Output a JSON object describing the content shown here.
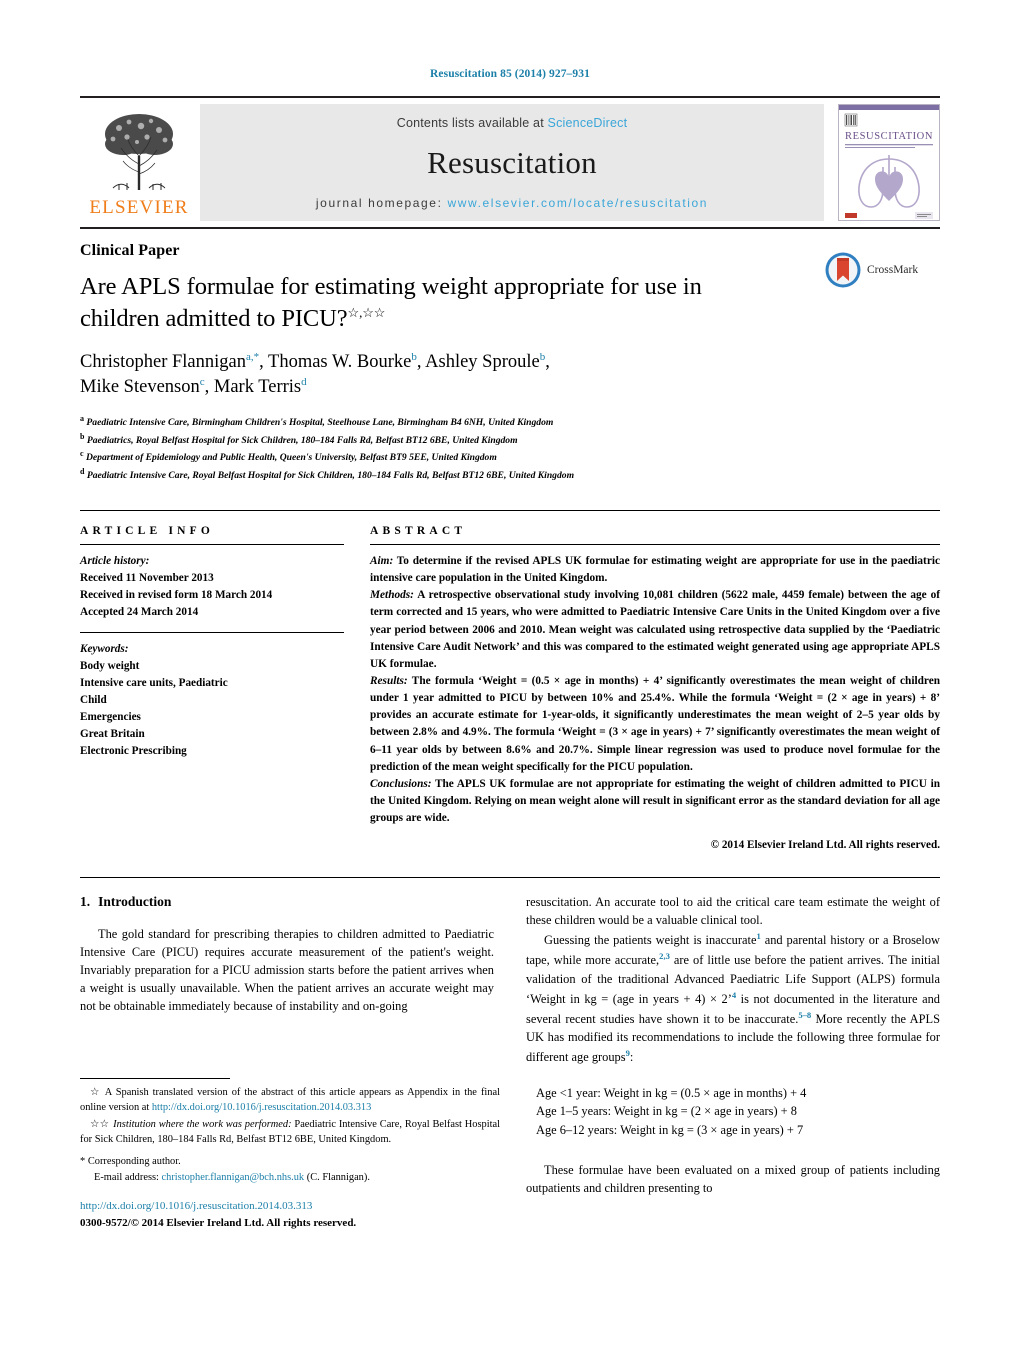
{
  "running_head": "Resuscitation 85 (2014) 927–931",
  "banner": {
    "publisher": "ELSEVIER",
    "contents_prefix": "Contents lists available at ",
    "contents_link": "ScienceDirect",
    "journal_name": "Resuscitation",
    "homepage_prefix": "journal homepage: ",
    "homepage_url": "www.elsevier.com/locate/resuscitation",
    "cover_title": "RESUSCITATION",
    "cover_subtitle": "OFFICIAL JOURNAL OF THE EUROPEAN RESUSCITATION COUNCIL"
  },
  "colors": {
    "link_blue": "#1b7fa8",
    "sciencedirect_blue": "#3aa6d8",
    "elsevier_orange": "#ef7d1a",
    "banner_grey": "#e8e8e9"
  },
  "article": {
    "kicker": "Clinical Paper",
    "title": "Are APLS formulae for estimating weight appropriate for use in children admitted to PICU?",
    "title_marks": "☆,☆☆",
    "authors_line1": "Christopher Flannigan",
    "authors": "Christopher Flannigan a,*, Thomas W. Bourke b, Ashley Sproule b, Mike Stevenson c, Mark Terris d",
    "affiliations": [
      {
        "mark": "a",
        "text": "Paediatric Intensive Care, Birmingham Children's Hospital, Steelhouse Lane, Birmingham B4 6NH, United Kingdom"
      },
      {
        "mark": "b",
        "text": "Paediatrics, Royal Belfast Hospital for Sick Children, 180–184 Falls Rd, Belfast BT12 6BE, United Kingdom"
      },
      {
        "mark": "c",
        "text": "Department of Epidemiology and Public Health, Queen's University, Belfast BT9 5EE, United Kingdom"
      },
      {
        "mark": "d",
        "text": "Paediatric Intensive Care, Royal Belfast Hospital for Sick Children, 180–184 Falls Rd, Belfast BT12 6BE, United Kingdom"
      }
    ],
    "crossmark_label": "CrossMark"
  },
  "article_info": {
    "heading": "ARTICLE INFO",
    "history_label": "Article history:",
    "history": [
      "Received 11 November 2013",
      "Received in revised form 18 March 2014",
      "Accepted 24 March 2014"
    ],
    "keywords_label": "Keywords:",
    "keywords": [
      "Body weight",
      "Intensive care units, Paediatric",
      "Child",
      "Emergencies",
      "Great Britain",
      "Electronic Prescribing"
    ]
  },
  "abstract": {
    "heading": "ABSTRACT",
    "aim_label": "Aim:",
    "aim_text": " To determine if the revised APLS UK formulae for estimating weight are appropriate for use in the paediatric intensive care population in the United Kingdom.",
    "methods_label": "Methods:",
    "methods_text": " A retrospective observational study involving 10,081 children (5622 male, 4459 female) between the age of term corrected and 15 years, who were admitted to Paediatric Intensive Care Units in the United Kingdom over a five year period between 2006 and 2010. Mean weight was calculated using retrospective data supplied by the ‘Paediatric Intensive Care Audit Network’ and this was compared to the estimated weight generated using age appropriate APLS UK formulae.",
    "results_label": "Results:",
    "results_text": " The formula ‘Weight = (0.5 × age in months) + 4’ significantly overestimates the mean weight of children under 1 year admitted to PICU by between 10% and 25.4%. While the formula ‘Weight = (2 × age in years) + 8’ provides an accurate estimate for 1-year-olds, it significantly underestimates the mean weight of 2–5 year olds by between 2.8% and 4.9%. The formula ‘Weight = (3 × age in years) + 7’ significantly overestimates the mean weight of 6–11 year olds by between 8.6% and 20.7%. Simple linear regression was used to produce novel formulae for the prediction of the mean weight specifically for the PICU population.",
    "conclusions_label": "Conclusions:",
    "conclusions_text": " The APLS UK formulae are not appropriate for estimating the weight of children admitted to PICU in the United Kingdom. Relying on mean weight alone will result in significant error as the standard deviation for all age groups are wide.",
    "copyright": "© 2014 Elsevier Ireland Ltd. All rights reserved."
  },
  "introduction": {
    "number": "1.",
    "heading": "Introduction",
    "p1": "The gold standard for prescribing therapies to children admitted to Paediatric Intensive Care (PICU) requires accurate measurement of the patient's weight. Invariably preparation for a PICU admission starts before the patient arrives when a weight is usually unavailable. When the patient arrives an accurate weight may not be obtainable immediately because of instability and on-going",
    "p1_cont": "resuscitation. An accurate tool to aid the critical care team estimate the weight of these children would be a valuable clinical tool.",
    "p2_a": "Guessing the patients weight is inaccurate",
    "p2_ref1": "1",
    "p2_b": " and parental history or a Broselow tape, while more accurate,",
    "p2_ref2": "2,3",
    "p2_c": " are of little use before the patient arrives. The initial validation of the traditional Advanced Paediatric Life Support (ALPS) formula ‘Weight in kg = (age in years + 4) × 2’",
    "p2_ref3": "4",
    "p2_d": " is not documented in the literature and several recent studies have shown it to be inaccurate.",
    "p2_ref4": "5–8",
    "p2_e": " More recently the APLS UK has modified its recommendations to include the following three formulae for different age groups",
    "p2_ref5": "9",
    "p2_f": ":",
    "formulae": [
      "Age <1 year: Weight in kg = (0.5 × age in months) + 4",
      "Age 1–5 years: Weight in kg = (2 × age in years) + 8",
      "Age 6–12 years: Weight in kg = (3 × age in years) + 7"
    ],
    "p3": "These formulae have been evaluated on a mixed group of patients including outpatients and children presenting to"
  },
  "footnotes": {
    "fn1_mark": "☆",
    "fn1_text": "A Spanish translated version of the abstract of this article appears as Appendix in the final online version at ",
    "fn1_link": "http://dx.doi.org/10.1016/j.resuscitation.2014.03.313",
    "fn2_mark": "☆☆",
    "fn2_italic": "Institution where the work was performed:",
    "fn2_text": " Paediatric Intensive Care, Royal Belfast Hospital for Sick Children, 180–184 Falls Rd, Belfast BT12 6BE, United Kingdom.",
    "corresponding_mark": "*",
    "corresponding_text": "Corresponding author.",
    "email_label": "E-mail address:",
    "email": "christopher.flannigan@bch.nhs.uk",
    "email_suffix": " (C. Flannigan).",
    "doi_url": "http://dx.doi.org/10.1016/j.resuscitation.2014.03.313",
    "issn_line": "0300-9572/© 2014 Elsevier Ireland Ltd. All rights reserved."
  }
}
